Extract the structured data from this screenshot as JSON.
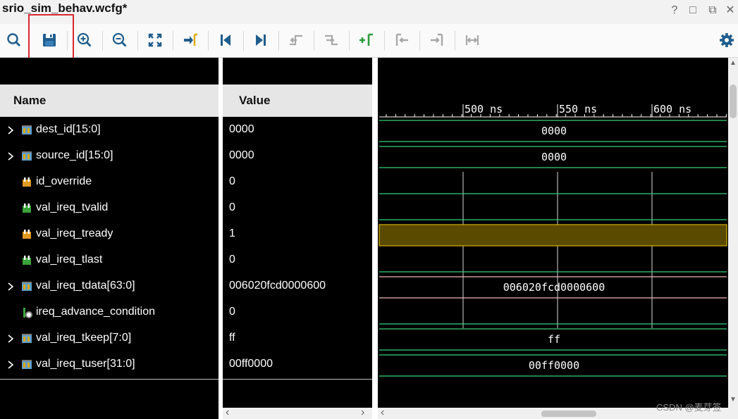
{
  "window": {
    "title": "srio_sim_behav.wcfg*",
    "controls": [
      {
        "name": "help-icon",
        "glyph": "?"
      },
      {
        "name": "restore-icon",
        "glyph": "□"
      },
      {
        "name": "float-icon",
        "glyph": "⧉"
      },
      {
        "name": "close-icon",
        "glyph": "✕"
      }
    ]
  },
  "toolbar": {
    "tools": [
      "search-icon",
      "save-icon",
      "zoom-in-icon",
      "zoom-out-icon",
      "zoom-fit-icon",
      "go-to-cursor-icon",
      "go-to-time-zero-icon",
      "go-to-last-time-icon",
      "previous-transition-icon",
      "next-transition-icon",
      "add-marker-icon",
      "previous-marker-icon",
      "next-marker-icon",
      "swap-cursors-icon",
      "settings-icon"
    ],
    "highlighted_tool": "save-icon",
    "highlight_color": "#d9272e"
  },
  "columns": {
    "name": "Name",
    "value": "Value"
  },
  "signals": [
    {
      "name": "dest_id[15:0]",
      "value": "0000",
      "kind": "bus",
      "expandable": true,
      "wave_label": "0000"
    },
    {
      "name": "source_id[15:0]",
      "value": "0000",
      "kind": "bus",
      "expandable": true,
      "wave_label": "0000"
    },
    {
      "name": "id_override",
      "value": "0",
      "kind": "bit-orange",
      "expandable": false,
      "level": 0
    },
    {
      "name": "val_ireq_tvalid",
      "value": "0",
      "kind": "bit-green",
      "expandable": false,
      "level": 0
    },
    {
      "name": "val_ireq_tready",
      "value": "1",
      "kind": "bit-orange",
      "expandable": false,
      "level": 1
    },
    {
      "name": "val_ireq_tlast",
      "value": "0",
      "kind": "bit-green",
      "expandable": false,
      "level": 0
    },
    {
      "name": "val_ireq_tdata[63:0]",
      "value": "006020fcd0000600",
      "kind": "bus",
      "expandable": true,
      "wave_label": "006020fcd0000600"
    },
    {
      "name": "ireq_advance_condition",
      "value": "0",
      "kind": "bit-gray",
      "expandable": false,
      "level": 0
    },
    {
      "name": "val_ireq_tkeep[7:0]",
      "value": "ff",
      "kind": "bus",
      "expandable": true,
      "wave_label": "ff"
    },
    {
      "name": "val_ireq_tuser[31:0]",
      "value": "00ff0000",
      "kind": "bus",
      "expandable": true,
      "wave_label": "00ff0000"
    }
  ],
  "timeline": {
    "tick_labels": [
      "500 ns",
      "550 ns",
      "600 ns"
    ],
    "colors": {
      "wave": "#33d17a",
      "active": "#c8a800",
      "active_fill": "#5a4a00",
      "tdata": "#f0b8b8"
    }
  },
  "watermark": "CSDN @麦芽签"
}
